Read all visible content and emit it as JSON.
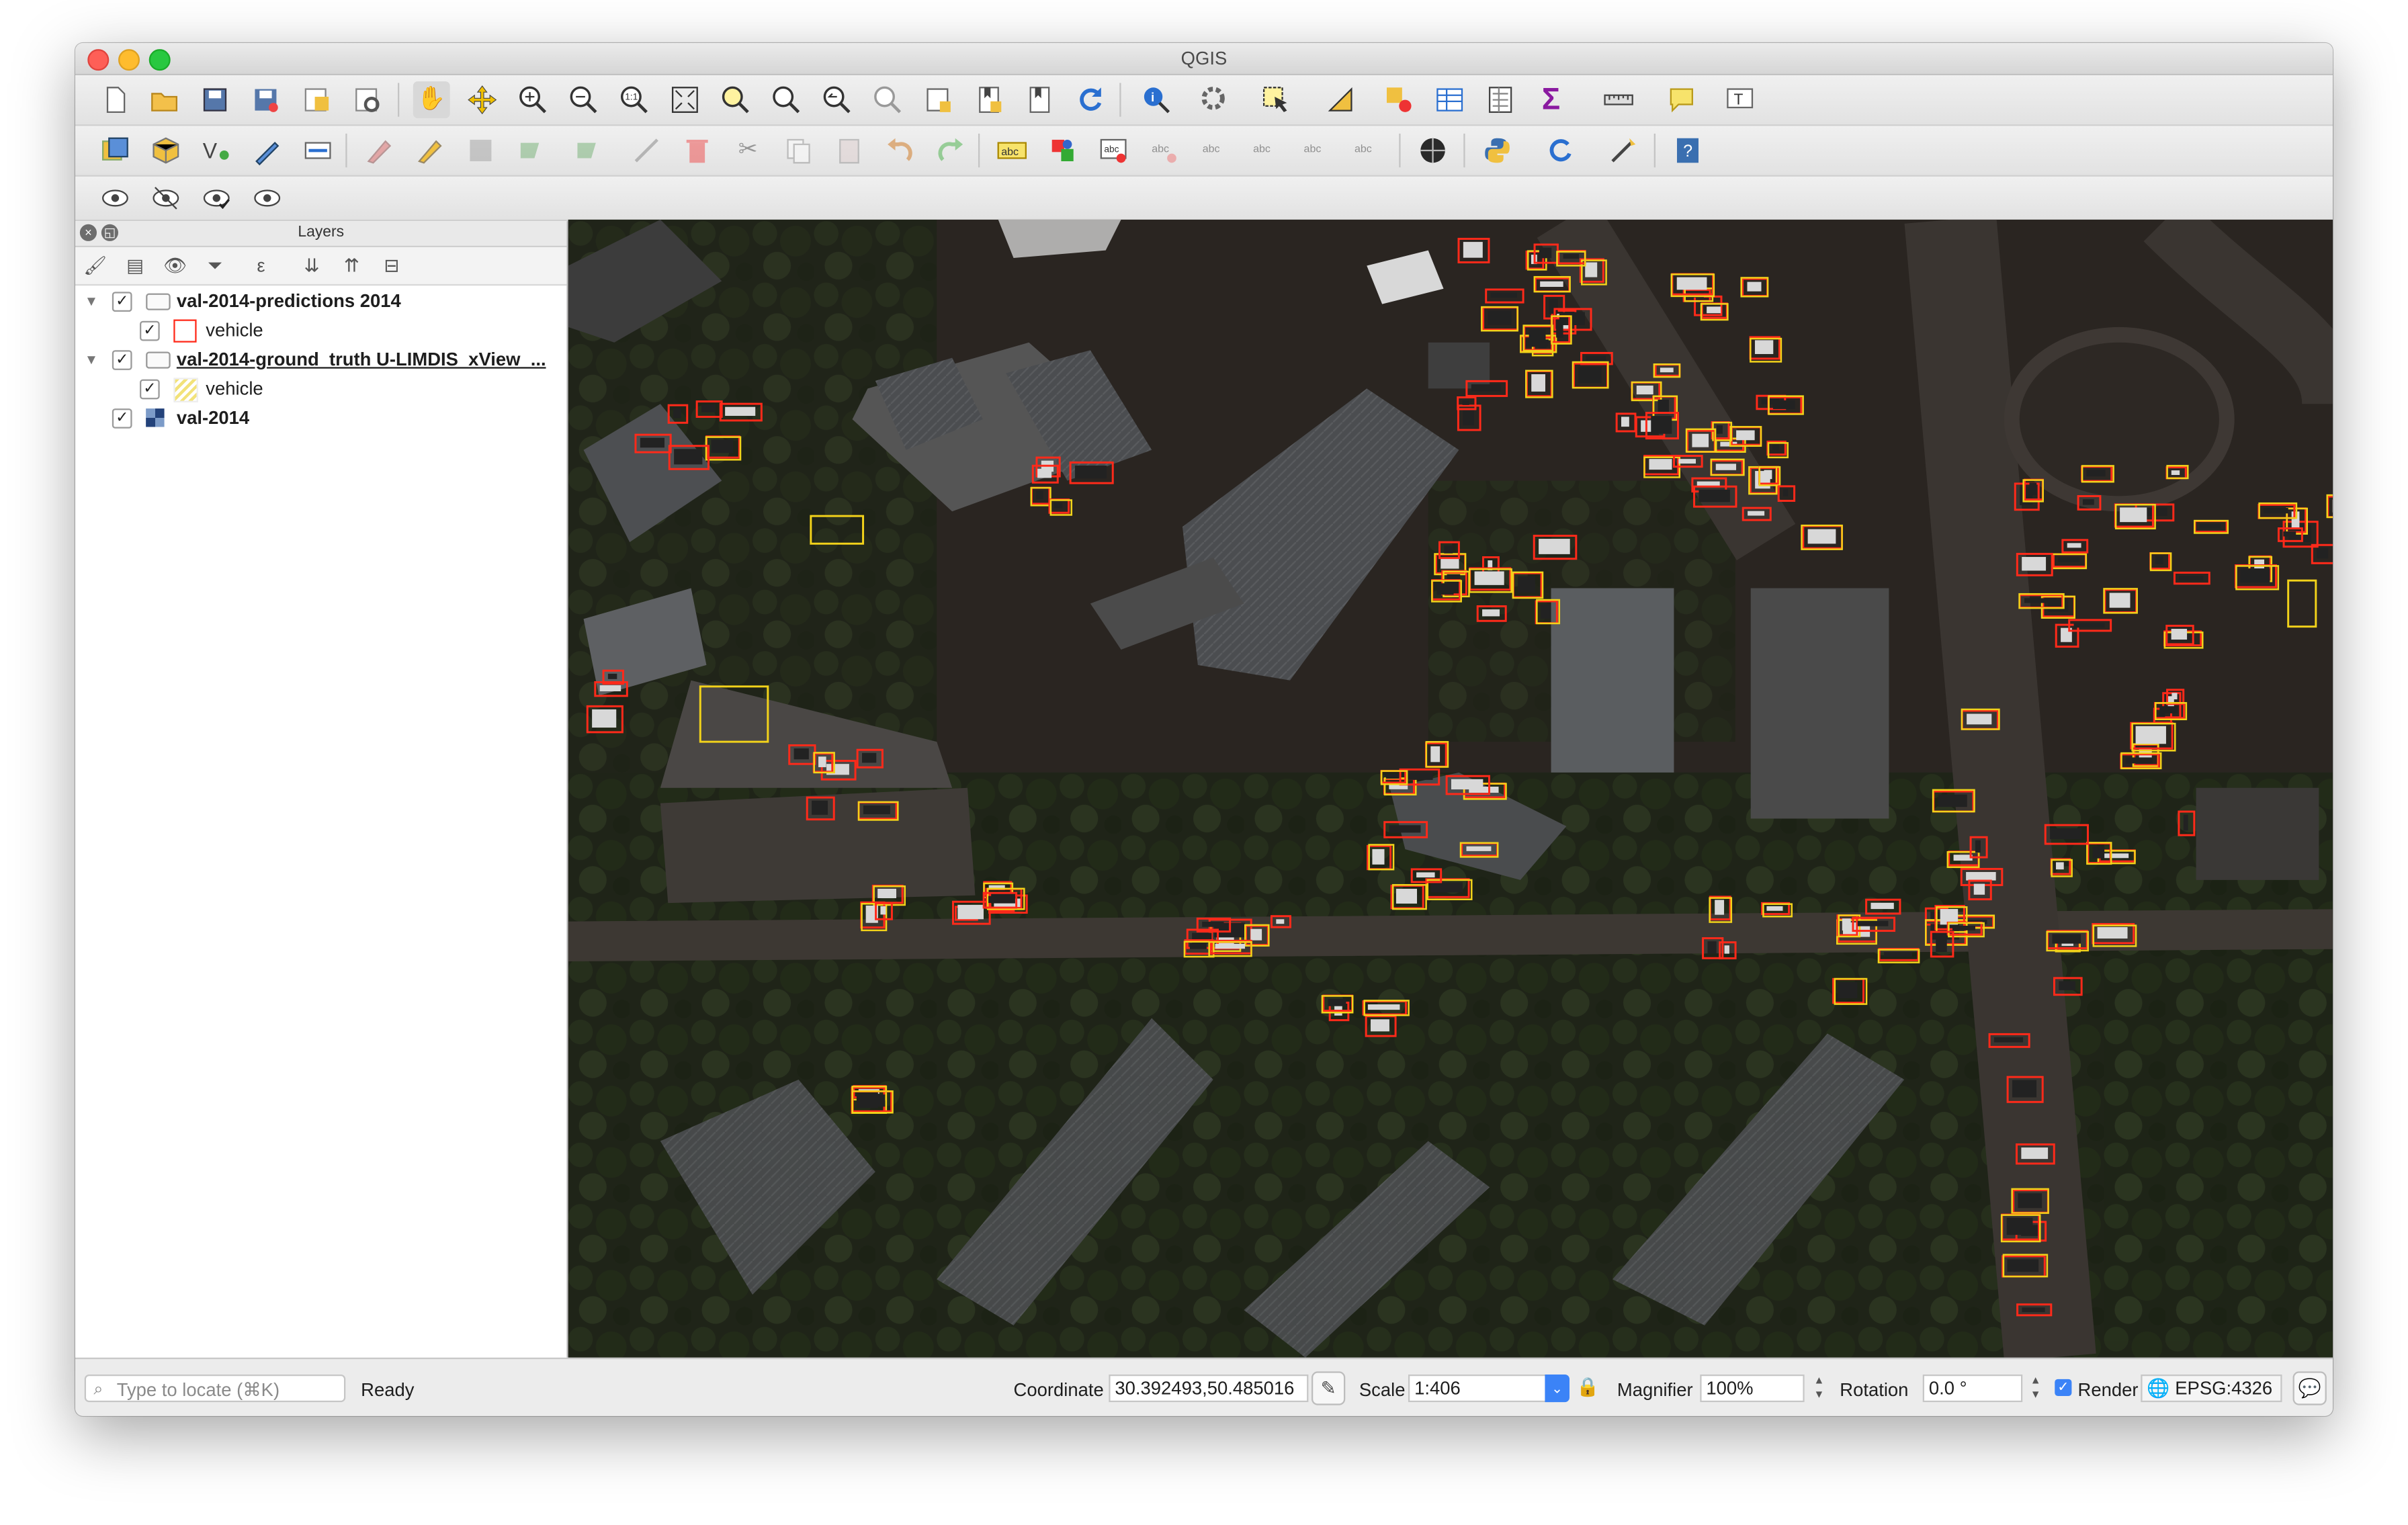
{
  "window": {
    "title": "QGIS"
  },
  "toolbar_icons": {
    "row1": [
      "new-project-icon",
      "open-project-icon",
      "save-project-icon",
      "save-as-icon",
      "print-composer-icon",
      "composer-manager-icon",
      "pan-icon",
      "pan-to-selection-icon",
      "zoom-in-icon",
      "zoom-out-icon",
      "zoom-native-icon",
      "zoom-full-icon",
      "zoom-selection-icon",
      "zoom-layer-icon",
      "zoom-last-icon",
      "zoom-next-icon",
      "new-map-view-icon",
      "new-bookmark-icon",
      "show-bookmarks-icon",
      "refresh-icon",
      "identify-icon",
      "action-icon",
      "select-icon",
      "select-value-icon",
      "deselect-icon",
      "attribute-table-icon",
      "field-calculator-icon",
      "statistics-icon",
      "measure-icon",
      "map-tips-icon",
      "text-annotation-icon"
    ],
    "row2": [
      "data-source-manager-icon",
      "new-geopackage-icon",
      "new-shapefile-icon",
      "digitize-icon",
      "current-edits-icon",
      "toggle-editing-icon",
      "pencil-icon",
      "save-edits-icon",
      "add-feature-icon",
      "move-feature-icon",
      "node-tool-icon",
      "delete-icon",
      "cut-icon",
      "copy-icon",
      "paste-icon",
      "undo-icon",
      "redo-icon",
      "label-icon",
      "diagram-icon",
      "label-pin-icon",
      "label-show-icon",
      "label-move-icon",
      "label-rotate-icon",
      "label-change-icon",
      "globe-icon",
      "python-icon",
      "processing-icon",
      "plugin-icon",
      "help-icon"
    ],
    "row3": [
      "show-all-layers-icon",
      "hide-all-layers-icon",
      "show-selected-icon",
      "toggle-layers-icon"
    ]
  },
  "layers_panel": {
    "title": "Layers",
    "layers": [
      {
        "name": "val-2014-predictions 2014",
        "checked": true,
        "expanded": true,
        "bold": true
      },
      {
        "name": "vehicle",
        "checked": true,
        "legend": "red-box"
      },
      {
        "name": "val-2014-ground_truth U-LIMDIS_xView_...",
        "checked": true,
        "expanded": true,
        "bold": true,
        "underline": true
      },
      {
        "name": "vehicle",
        "checked": true,
        "legend": "yellow-hatch"
      },
      {
        "name": "val-2014",
        "checked": true,
        "bold": true
      }
    ]
  },
  "status": {
    "locate_placeholder": "Type to locate (⌘K)",
    "message": "Ready",
    "coordinate_label": "Coordinate",
    "coordinate_value": "30.392493,50.485016",
    "scale_label": "Scale",
    "scale_value": "1:406",
    "magnifier_label": "Magnifier",
    "magnifier_value": "100%",
    "rotation_label": "Rotation",
    "rotation_value": "0.0 °",
    "render_label": "Render",
    "render_checked": true,
    "crs_label": "EPSG:4326"
  },
  "colors": {
    "prediction_box": "#ff2a1a",
    "ground_truth_box": "#f2d21a",
    "imagery_base": "#26221f"
  }
}
